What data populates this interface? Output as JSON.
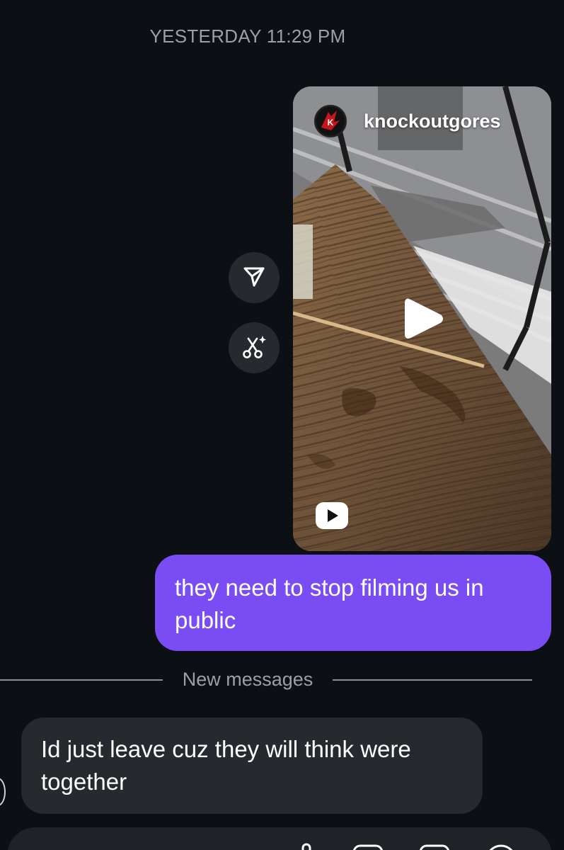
{
  "thread": {
    "timestamp": "YESTERDAY 11:29 PM"
  },
  "reel": {
    "username": "knockoutgores",
    "avatar_icon": "knockout-logo-icon",
    "play_icon": "play-icon",
    "badge_icon": "reels-badge-icon"
  },
  "actions": {
    "share_icon": "send-icon",
    "remix_icon": "scissors-sparkle-icon"
  },
  "messages": {
    "outgoing": {
      "text": "they need to stop filming us in public",
      "color": "#7a4df4"
    },
    "divider_label": "New messages",
    "incoming": {
      "text": "Id just leave cuz they will think were together",
      "color": "#262a2f"
    }
  },
  "colors": {
    "background": "#0c1014",
    "muted_text": "#9aa0a6",
    "button_bg": "#262a2f"
  }
}
